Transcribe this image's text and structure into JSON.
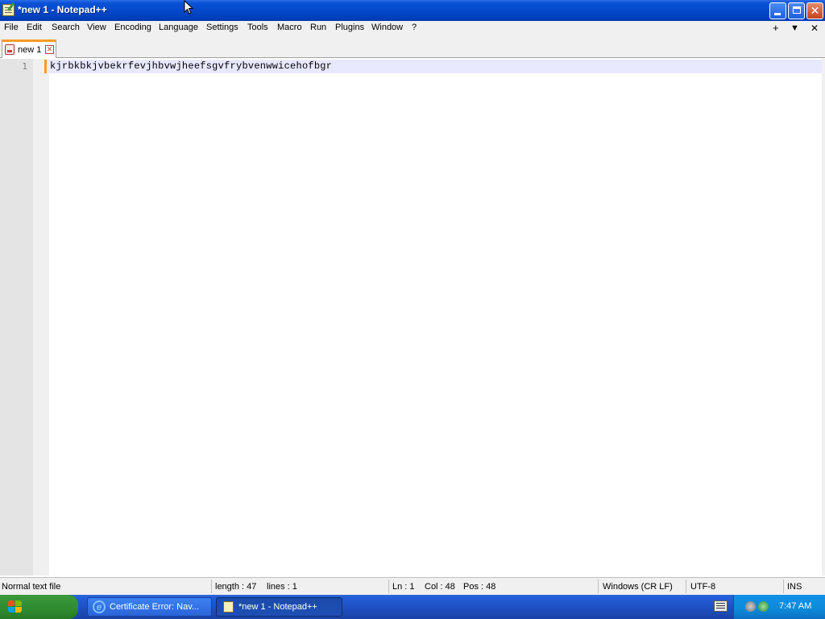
{
  "window": {
    "title": "*new 1 - Notepad++"
  },
  "menu": {
    "items": [
      "File",
      "Edit",
      "Search",
      "View",
      "Encoding",
      "Language",
      "Settings",
      "Tools",
      "Macro",
      "Run",
      "Plugins",
      "Window",
      "?"
    ],
    "right": {
      "plus": "+",
      "dropdown": "▼",
      "close": "✕"
    }
  },
  "tabs": [
    {
      "label": "new 1",
      "modified": true
    }
  ],
  "editor": {
    "line_number": "1",
    "content": "kjrbkbkjvbekrfevjhbvwjheefsgvfrybvenwwicehofbgr"
  },
  "status": {
    "file_type": "Normal text file",
    "length": "length : 47",
    "lines": "lines : 1",
    "ln": "Ln : 1",
    "col": "Col : 48",
    "pos": "Pos : 48",
    "eol": "Windows (CR LF)",
    "encoding": "UTF-8",
    "mode": "INS"
  },
  "taskbar": {
    "items": [
      {
        "label": "Certificate Error: Nav...",
        "icon": "internet-explorer-icon",
        "active": false
      },
      {
        "label": "*new 1 - Notepad++",
        "icon": "notepad-plus-plus-icon",
        "active": true
      }
    ],
    "clock": "7:47 AM"
  },
  "colors": {
    "title_bar": "#0a52d6",
    "tab_accent": "#fa9b28",
    "current_line": "#e8e8ff",
    "taskbar": "#245edb",
    "start_button": "#3c9a3c"
  }
}
